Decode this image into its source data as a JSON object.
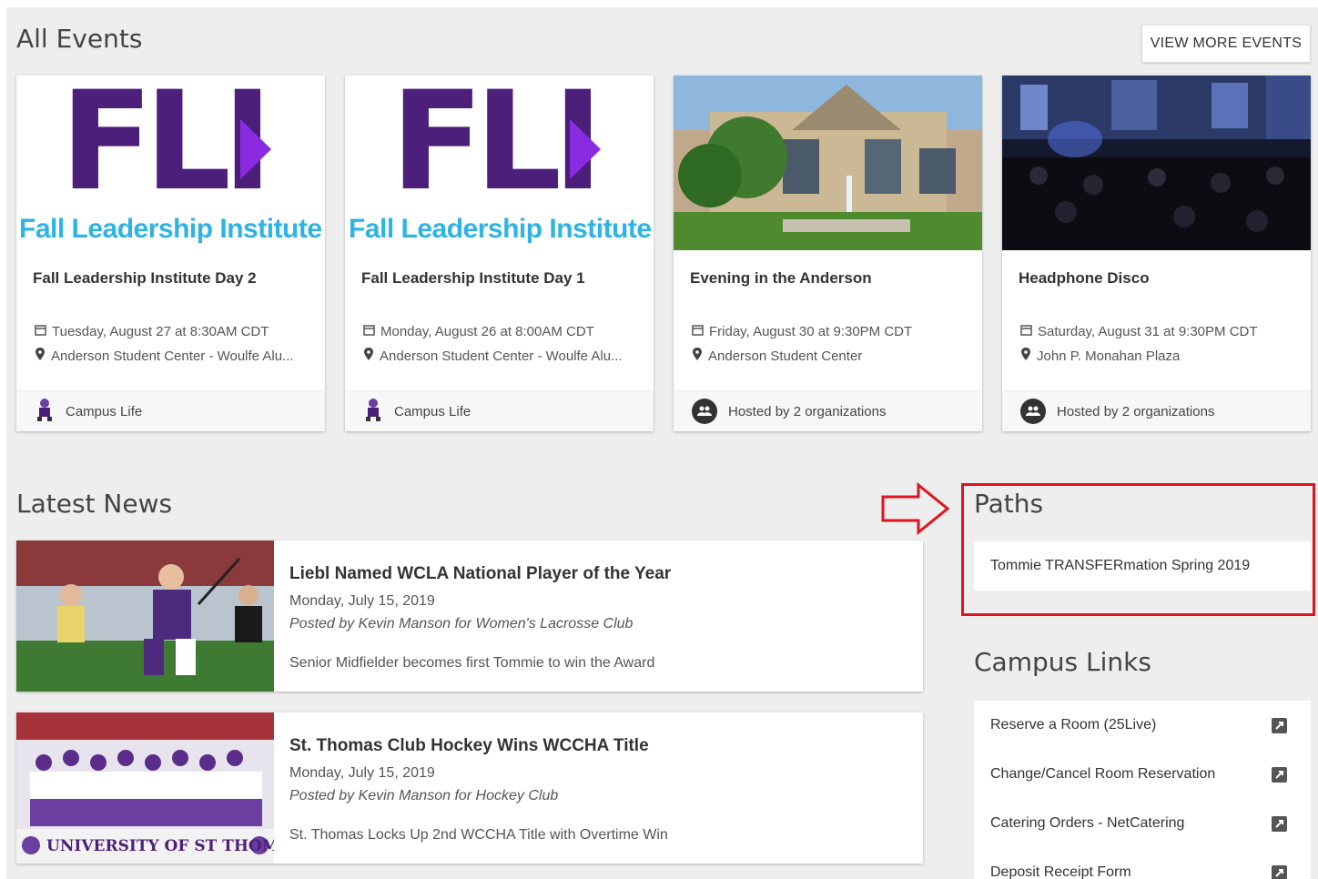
{
  "events_section": {
    "title": "All Events",
    "view_more_label": "VIEW MORE EVENTS"
  },
  "events": [
    {
      "logo_text": "FLI",
      "logo_subtitle": "Fall Leadership Institute",
      "title": "Fall Leadership Institute Day 2",
      "datetime": "Tuesday, August 27 at 8:30AM CDT",
      "location": "Anderson Student Center - Woulfe Alu...",
      "host": "Campus Life"
    },
    {
      "logo_text": "FLI",
      "logo_subtitle": "Fall Leadership Institute",
      "title": "Fall Leadership Institute Day 1",
      "datetime": "Monday, August 26 at 8:00AM CDT",
      "location": "Anderson Student Center - Woulfe Alu...",
      "host": "Campus Life"
    },
    {
      "title": "Evening in the Anderson",
      "datetime": "Friday, August 30 at 9:30PM CDT",
      "location": "Anderson Student Center",
      "host": "Hosted by 2 organizations"
    },
    {
      "title": "Headphone Disco",
      "datetime": "Saturday, August 31 at 9:30PM CDT",
      "location": "John P. Monahan Plaza",
      "host": "Hosted by 2 organizations"
    }
  ],
  "news_section": {
    "title": "Latest News"
  },
  "news": [
    {
      "title": "Liebl Named WCLA National Player of the Year",
      "date": "Monday, July 15, 2019",
      "posted_by": "Posted by Kevin Manson for Women's Lacrosse Club",
      "summary": "Senior Midfielder becomes first Tommie to win the Award"
    },
    {
      "title": "St. Thomas Club Hockey Wins WCCHA Title",
      "date": "Monday, July 15, 2019",
      "posted_by": "Posted by Kevin Manson for Hockey Club",
      "summary": "St. Thomas Locks Up 2nd WCCHA Title with Overtime Win",
      "image_banner": "UNIVERSITY OF ST THOMAS"
    }
  ],
  "paths": {
    "title": "Paths",
    "items": [
      "Tommie TRANSFERmation Spring 2019"
    ]
  },
  "campus_links": {
    "title": "Campus Links",
    "items": [
      "Reserve a Room (25Live)",
      "Change/Cancel Room Reservation",
      "Catering Orders - NetCatering",
      "Deposit Receipt Form"
    ]
  },
  "colors": {
    "fli_purple": "#4b1f7a",
    "fli_violet": "#8a2be2",
    "fli_cyan": "#2db3e6",
    "highlight_red": "#e0141e"
  }
}
